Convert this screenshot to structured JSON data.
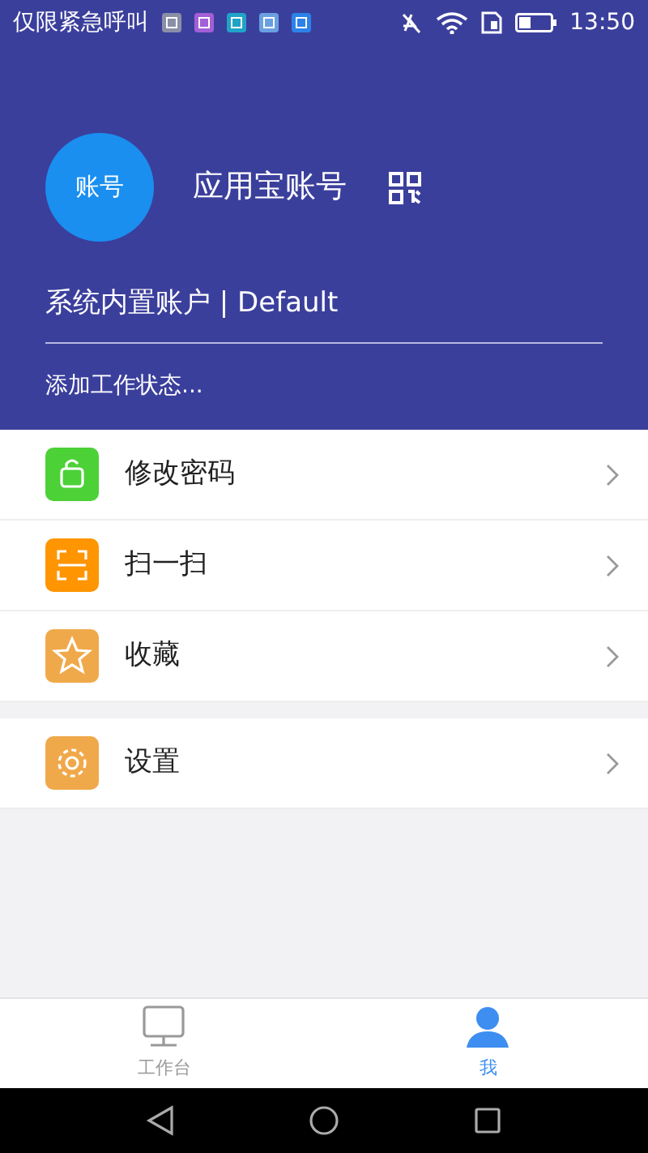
{
  "status_bar": {
    "carrier": "仅限紧急呼叫",
    "time": "13:50"
  },
  "profile": {
    "avatar_text": "账号",
    "name": "应用宝账号",
    "account": "系统内置账户 | Default",
    "work_status": "添加工作状态..."
  },
  "menu_groups": [
    [
      {
        "label": "修改密码",
        "kind": "lock",
        "color": "#4cd137"
      },
      {
        "label": "扫一扫",
        "kind": "scan",
        "color": "#ff9500"
      },
      {
        "label": "收藏",
        "kind": "star",
        "color": "#f0a94a"
      }
    ],
    [
      {
        "label": "设置",
        "kind": "gear",
        "color": "#f0a94a"
      }
    ]
  ],
  "tabs": [
    {
      "label": "工作台",
      "kind": "desk",
      "selected": false
    },
    {
      "label": "我",
      "kind": "person",
      "selected": true
    }
  ]
}
